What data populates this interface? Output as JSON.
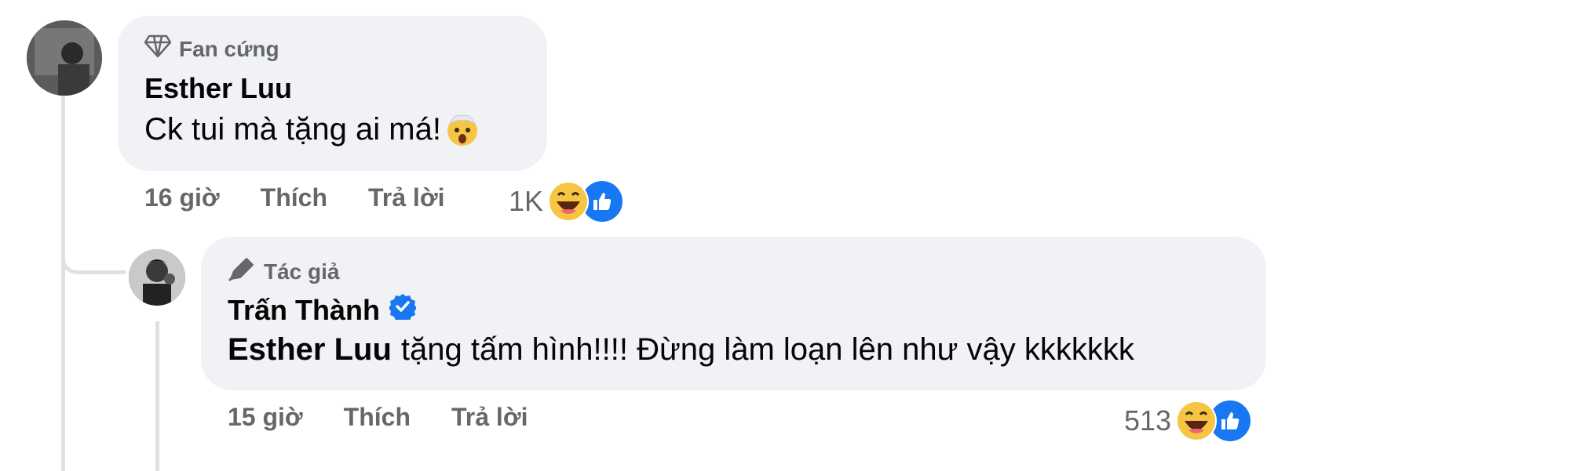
{
  "comment1": {
    "badge": "Fan cứng",
    "author": "Esther Luu",
    "text": "Ck tui mà tặng ai má!",
    "time": "16 giờ",
    "like_label": "Thích",
    "reply_label": "Trả lời",
    "reaction_count": "1K",
    "icons": [
      "diamond-icon",
      "exploding-head-emoji",
      "laugh-emoji",
      "like-icon"
    ]
  },
  "comment2": {
    "badge": "Tác giả",
    "author": "Trấn Thành",
    "mention": "Esther Luu",
    "text": "tặng tấm hình!!!! Đừng làm loạn lên như vậy kkkkkkk",
    "time": "15 giờ",
    "like_label": "Thích",
    "reply_label": "Trả lời",
    "reaction_count": "513",
    "icons": [
      "pen-icon",
      "verified-icon",
      "laugh-emoji",
      "like-icon"
    ]
  },
  "colors": {
    "bubble": "#f0f2f5",
    "secondary_text": "#65676b",
    "accent": "#1877f2",
    "thread_line": "#dfe1e5"
  }
}
